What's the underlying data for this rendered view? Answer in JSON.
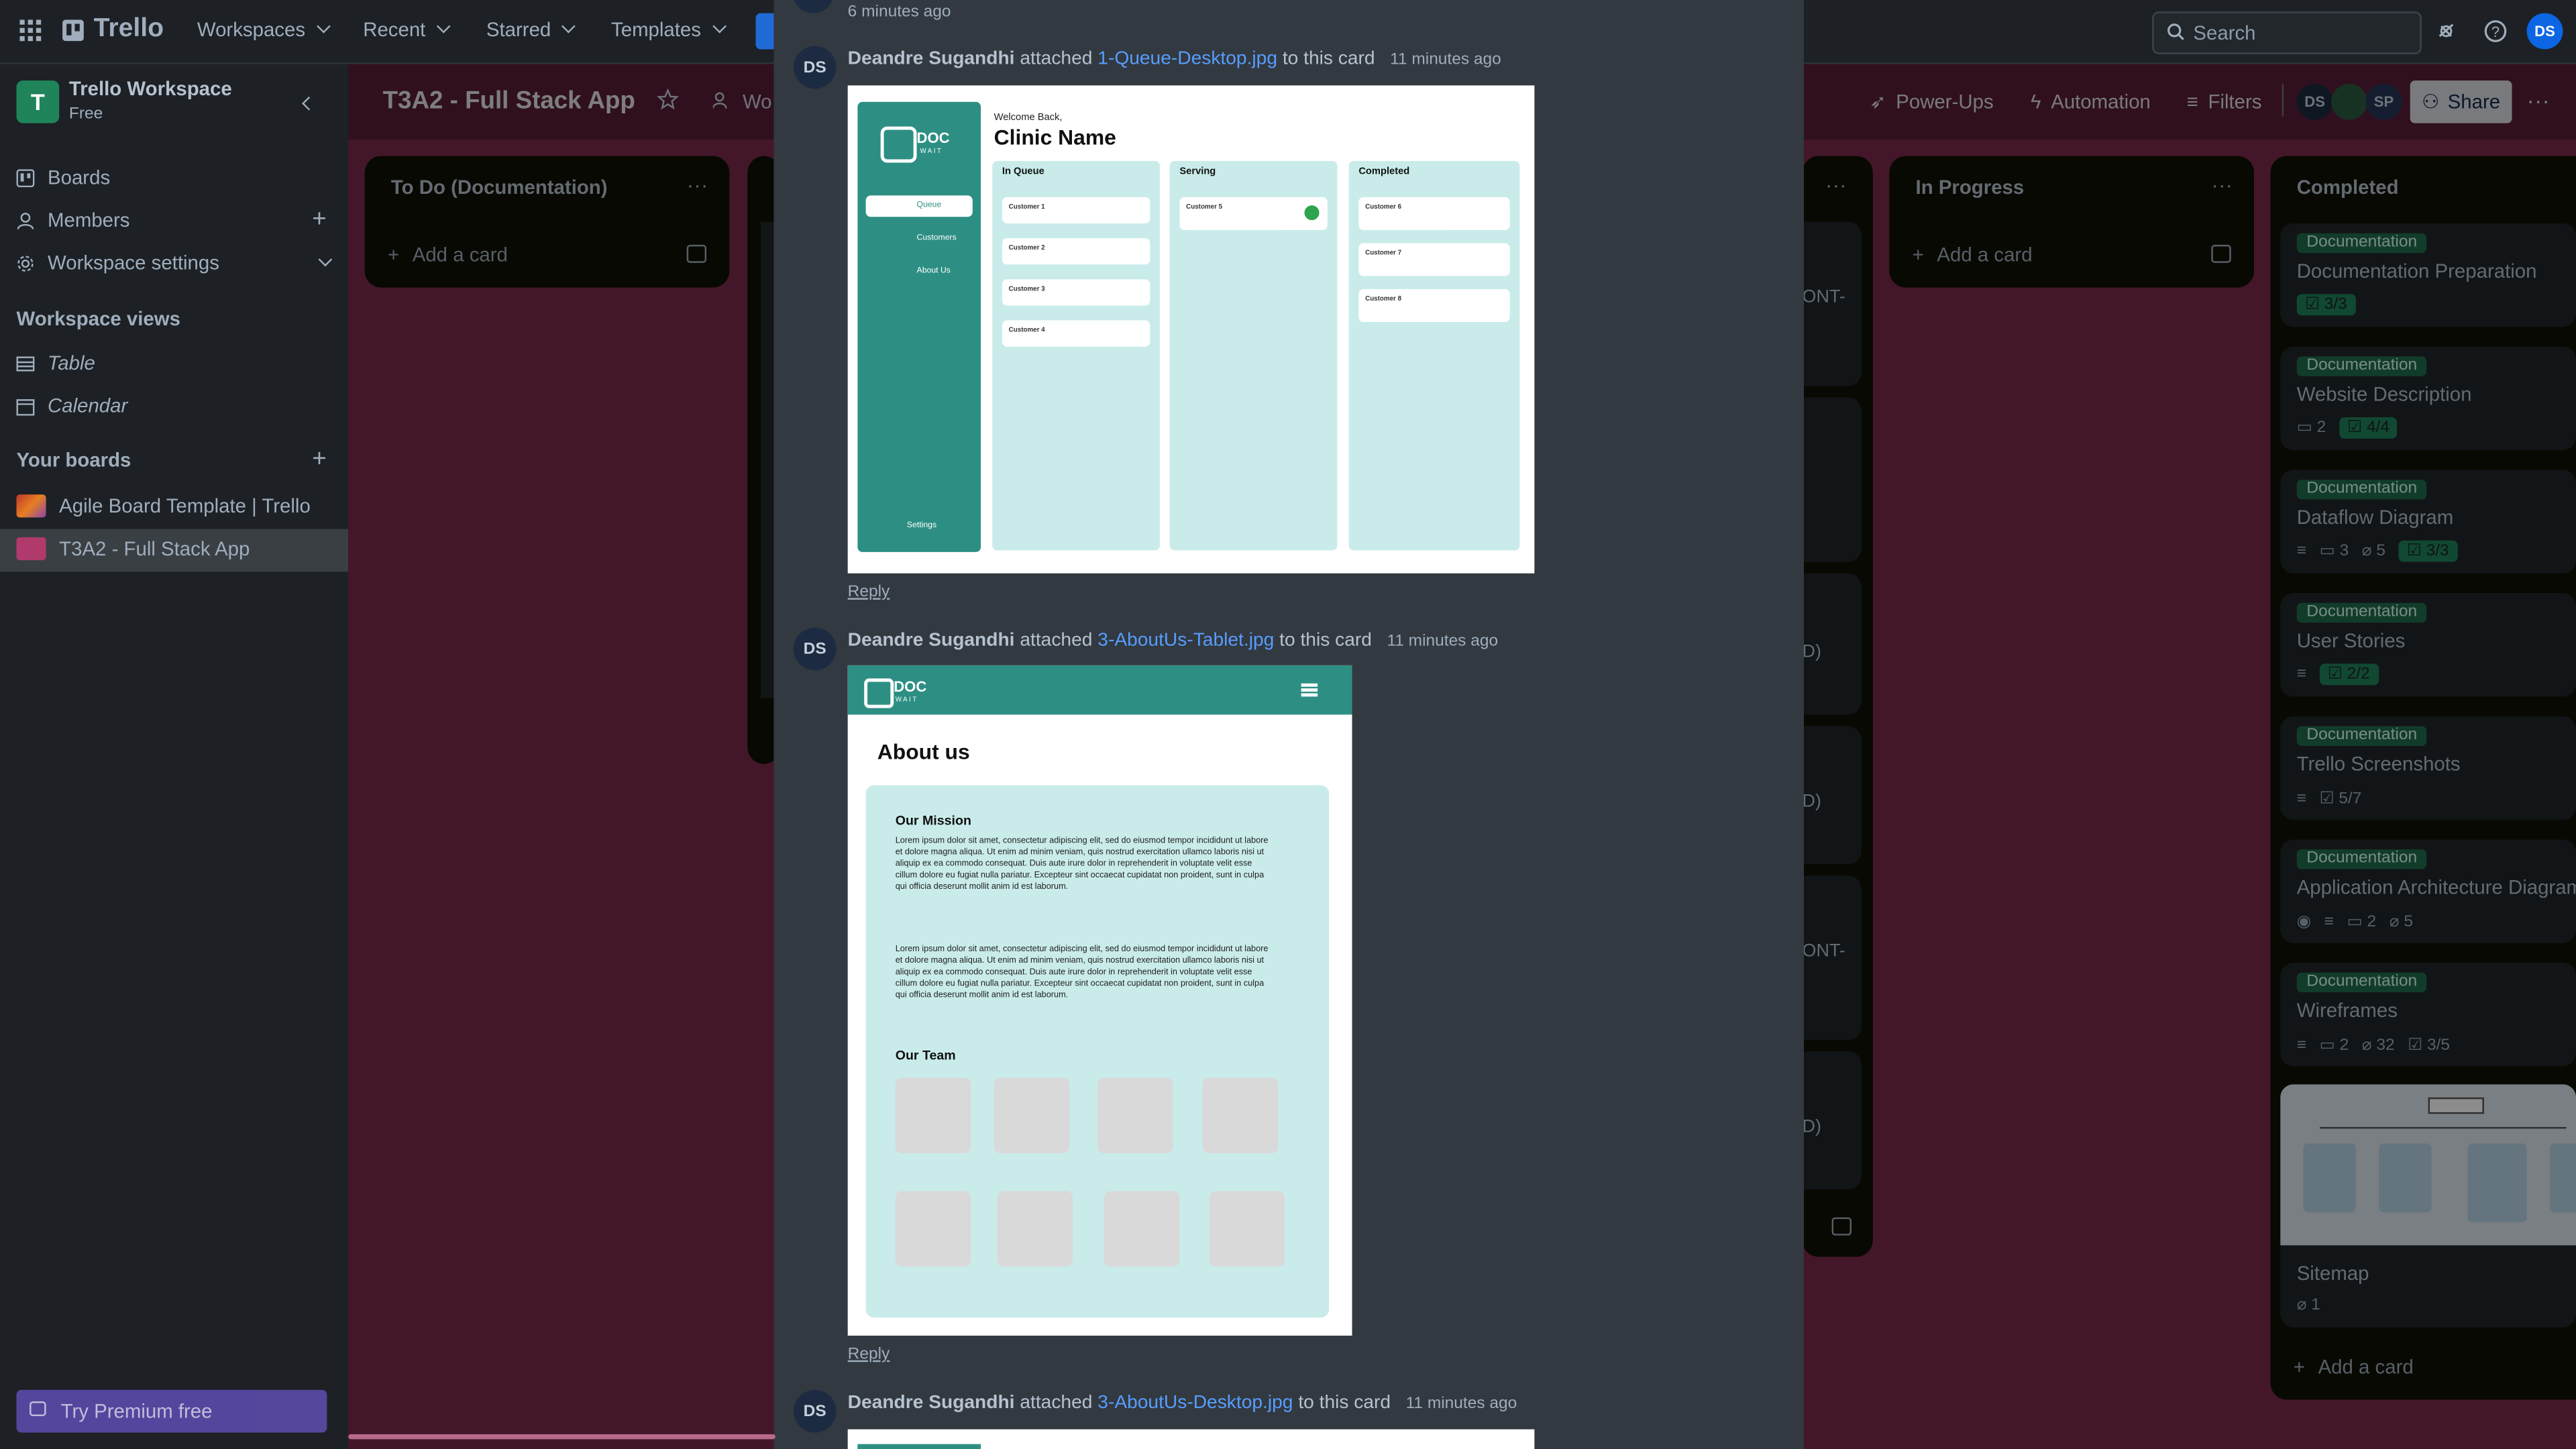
{
  "topbar": {
    "logo": "Trello",
    "menus": [
      "Workspaces",
      "Recent",
      "Starred",
      "Templates"
    ],
    "search_placeholder": "Search",
    "user_initials": "DS"
  },
  "sidebar": {
    "workspace_name": "Trello Workspace",
    "workspace_plan": "Free",
    "workspace_initial": "T",
    "items": [
      "Boards",
      "Members",
      "Workspace settings"
    ],
    "views_heading": "Workspace views",
    "views": [
      "Table",
      "Calendar"
    ],
    "your_boards_heading": "Your boards",
    "boards": [
      "Agile Board Template | Trello",
      "T3A2 - Full Stack App"
    ],
    "premium_button": "Try Premium free"
  },
  "board_header": {
    "title": "T3A2 - Full Stack App",
    "visibility_partial": "Wo",
    "power_ups": "Power-Ups",
    "automation": "Automation",
    "filters": "Filters",
    "members": [
      "DS",
      "SP"
    ],
    "share": "Share"
  },
  "lists": {
    "todo": {
      "title": "To Do (Documentation)",
      "add_card": "Add a card"
    },
    "in_progress": {
      "title": "In Progress",
      "add_card": "Add a card"
    },
    "hidden_fragments": [
      "ONT-",
      "D)",
      "D)",
      "ONT-",
      "D)"
    ],
    "completed": {
      "title": "Completed",
      "add_card": "Add a card",
      "cards": [
        {
          "label": "Documentation",
          "title": "Documentation Preparation",
          "checklist": "3/3"
        },
        {
          "label": "Documentation",
          "title": "Website Description",
          "comments": "2",
          "checklist": "4/4"
        },
        {
          "label": "Documentation",
          "title": "Dataflow Diagram",
          "comments": "3",
          "attachments": "5",
          "checklist": "3/3"
        },
        {
          "label": "Documentation",
          "title": "User Stories",
          "checklist": "2/2"
        },
        {
          "label": "Documentation",
          "title": "Trello Screenshots",
          "checklist": "5/7"
        },
        {
          "label": "Documentation",
          "title": "Application Architecture Diagram",
          "comments": "2",
          "attachments": "5"
        },
        {
          "label": "Documentation",
          "title": "Wireframes",
          "comments": "2",
          "attachments": "32",
          "checklist": "3/5"
        },
        {
          "title": "Sitemap",
          "attachments": "1"
        }
      ]
    }
  },
  "activity": {
    "first_time": "6 minutes ago",
    "entries": [
      {
        "initials": "DS",
        "user": "Deandre Sugandhi",
        "verb": "attached",
        "file": "1-Queue-Desktop.jpg",
        "suffix": "to this card",
        "time": "11 minutes ago",
        "reply": "Reply"
      },
      {
        "initials": "DS",
        "user": "Deandre Sugandhi",
        "verb": "attached",
        "file": "3-AboutUs-Tablet.jpg",
        "suffix": "to this card",
        "time": "11 minutes ago",
        "reply": "Reply"
      },
      {
        "initials": "DS",
        "user": "Deandre Sugandhi",
        "verb": "attached",
        "file": "3-AboutUs-Desktop.jpg",
        "suffix": "to this card",
        "time": "11 minutes ago"
      }
    ]
  },
  "attachment_queue": {
    "brand_top": "DOC",
    "brand_bottom": "WAIT",
    "nav": [
      "Queue",
      "Customers",
      "About Us"
    ],
    "settings": "Settings",
    "welcome": "Welcome Back,",
    "clinic": "Clinic Name",
    "columns": [
      {
        "title": "In Queue",
        "customers": [
          "Customer 1",
          "Customer 2",
          "Customer 3",
          "Customer 4"
        ]
      },
      {
        "title": "Serving",
        "customers": [
          "Customer 5"
        ]
      },
      {
        "title": "Completed",
        "customers": [
          "Customer 6",
          "Customer 7",
          "Customer 8"
        ]
      }
    ]
  },
  "attachment_about": {
    "brand_top": "DOC",
    "brand_bottom": "WAIT",
    "heading": "About us",
    "mission": "Our Mission",
    "lorem": "Lorem ipsum dolor sit amet, consectetur adipiscing elit, sed do eiusmod tempor incididunt ut labore et dolore magna aliqua. Ut enim ad minim veniam, quis nostrud exercitation ullamco laboris nisi ut aliquip ex ea commodo consequat. Duis aute irure dolor in reprehenderit in voluptate velit esse cillum dolore eu fugiat nulla pariatur. Excepteur sint occaecat cupidatat non proident, sunt in culpa qui officia deserunt mollit anim id est laborum.",
    "team": "Our Team"
  },
  "colors": {
    "accent_blue": "#579dff",
    "label_green": "#216e4e",
    "board_bg": "#7a2a4c",
    "teal": "#2d8f84"
  }
}
